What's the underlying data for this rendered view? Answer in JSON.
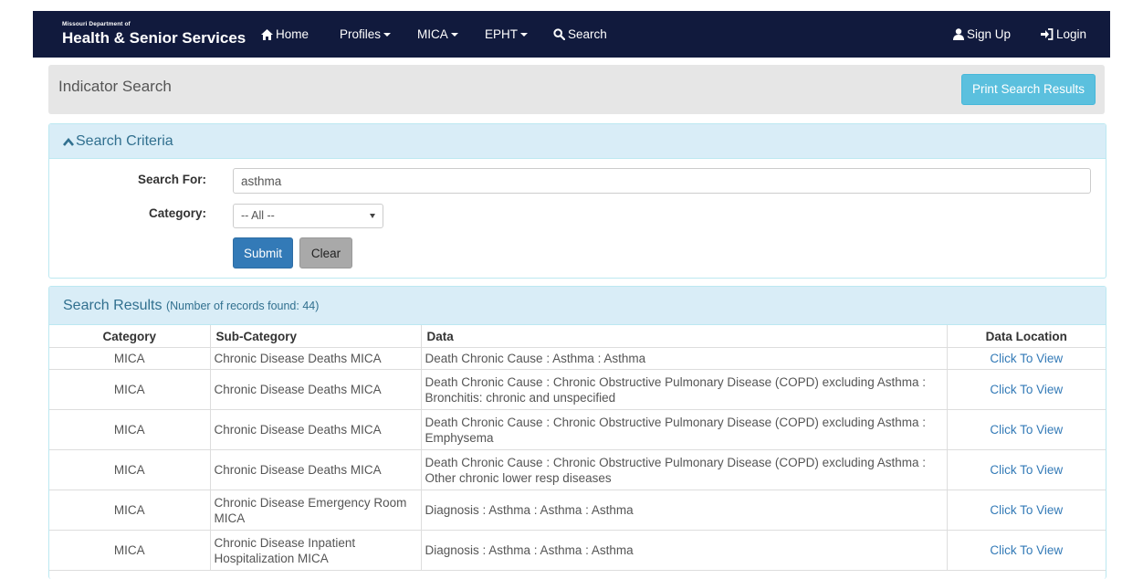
{
  "navbar": {
    "brand_small": "Missouri Department of",
    "brand_big": "Health & Senior Services",
    "items": [
      {
        "label": "Home",
        "icon": "home-icon"
      },
      {
        "label": "Profiles",
        "dropdown": true
      },
      {
        "label": "MICA",
        "dropdown": true
      },
      {
        "label": "EPHT",
        "dropdown": true
      },
      {
        "label": "Search",
        "icon": "search-icon"
      }
    ],
    "signup": {
      "label": "Sign Up",
      "icon": "user-icon"
    },
    "login": {
      "label": "Login",
      "icon": "login-icon"
    },
    "background": "#111a3d"
  },
  "header": {
    "title": "Indicator Search",
    "print_label": "Print Search Results"
  },
  "criteria": {
    "heading": "Search Criteria",
    "search_label": "Search For:",
    "search_value": "asthma",
    "category_label": "Category:",
    "category_value": "-- All --",
    "submit_label": "Submit",
    "clear_label": "Clear"
  },
  "results": {
    "heading": "Search Results",
    "count_text": "(Number of records found: 44)",
    "columns": [
      "Category",
      "Sub-Category",
      "Data",
      "Data Location"
    ],
    "rows": [
      {
        "category": "MICA",
        "subcategory": "Chronic Disease Deaths MICA",
        "data": "Death Chronic Cause : Asthma : Asthma",
        "location": "Click To View"
      },
      {
        "category": "MICA",
        "subcategory": "Chronic Disease Deaths MICA",
        "data": "Death Chronic Cause : Chronic Obstructive Pulmonary Disease (COPD) excluding Asthma : Bronchitis: chronic and unspecified",
        "location": "Click To View"
      },
      {
        "category": "MICA",
        "subcategory": "Chronic Disease Deaths MICA",
        "data": "Death Chronic Cause : Chronic Obstructive Pulmonary Disease (COPD) excluding Asthma : Emphysema",
        "location": "Click To View"
      },
      {
        "category": "MICA",
        "subcategory": "Chronic Disease Deaths MICA",
        "data": "Death Chronic Cause : Chronic Obstructive Pulmonary Disease (COPD) excluding Asthma : Other chronic lower resp diseases",
        "location": "Click To View"
      },
      {
        "category": "MICA",
        "subcategory": "Chronic Disease Emergency Room MICA",
        "data": "Diagnosis : Asthma : Asthma : Asthma",
        "location": "Click To View"
      },
      {
        "category": "MICA",
        "subcategory": "Chronic Disease Inpatient Hospitalization MICA",
        "data": "Diagnosis : Asthma : Asthma : Asthma",
        "location": "Click To View"
      }
    ]
  },
  "colors": {
    "panel_heading_bg": "#d9edf7",
    "panel_heading_text": "#31708f",
    "link": "#337ab7",
    "info_button": "#5bc0de",
    "primary_button": "#337ab7"
  }
}
